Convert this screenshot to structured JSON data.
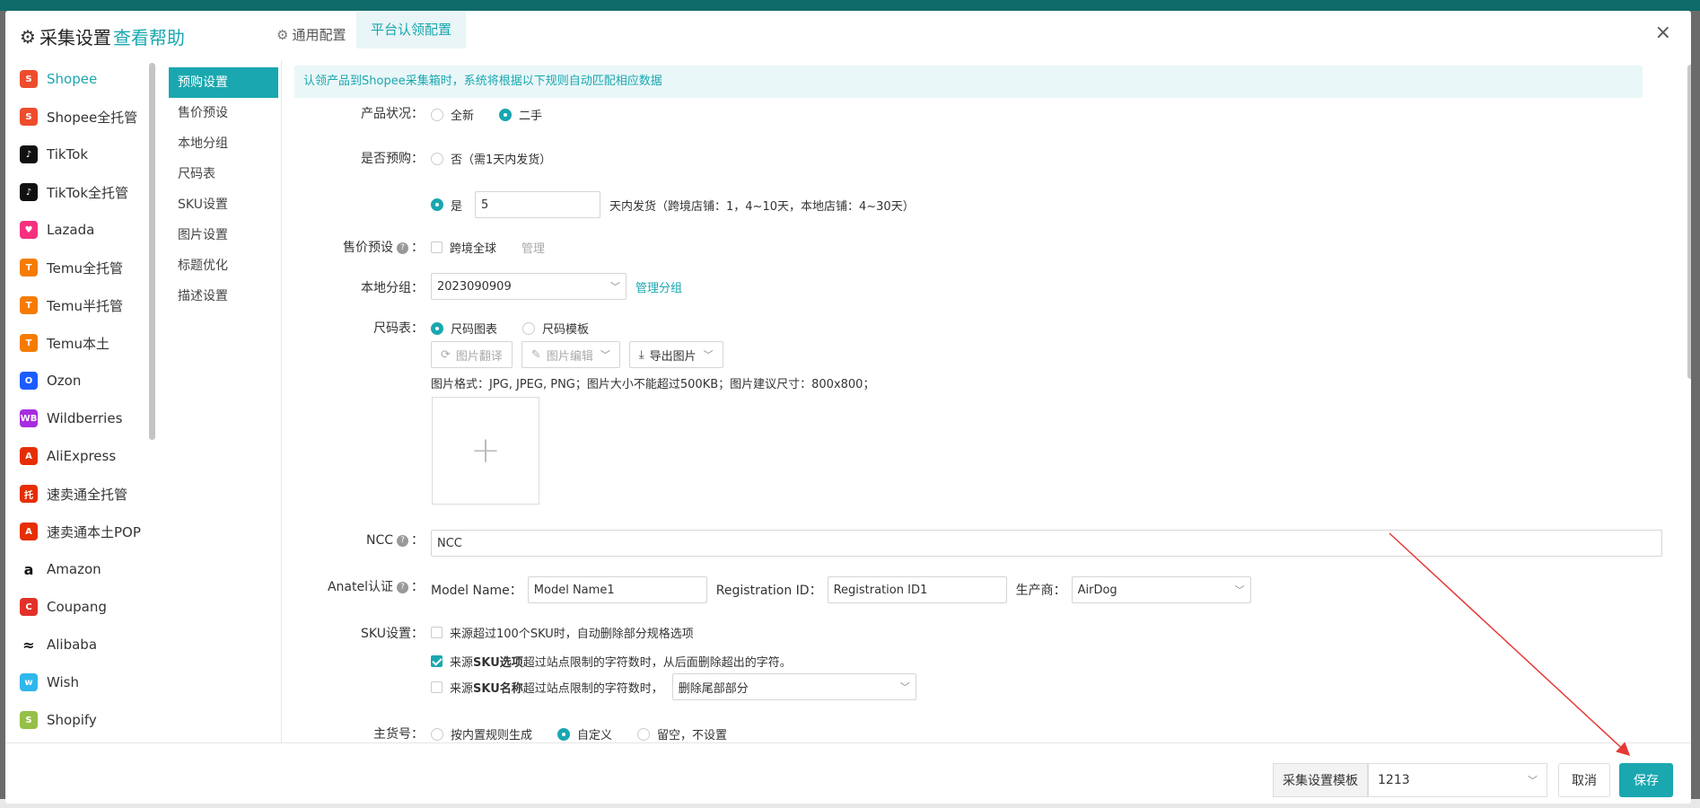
{
  "header": {
    "title": "采集设置",
    "help": "查看帮助",
    "tabs": [
      {
        "label": "通用配置"
      },
      {
        "label": "平台认领配置"
      }
    ],
    "close": "×"
  },
  "platforms": [
    {
      "label": "Shopee",
      "color": "#ee4d2d",
      "glyph": "S"
    },
    {
      "label": "Shopee全托管",
      "color": "#ee4d2d",
      "glyph": "S"
    },
    {
      "label": "TikTok",
      "color": "#111111",
      "glyph": "♪"
    },
    {
      "label": "TikTok全托管",
      "color": "#111111",
      "glyph": "♪"
    },
    {
      "label": "Lazada",
      "color": "#f5317f",
      "glyph": "♥"
    },
    {
      "label": "Temu全托管",
      "color": "#f57c00",
      "glyph": "T"
    },
    {
      "label": "Temu半托管",
      "color": "#f57c00",
      "glyph": "T"
    },
    {
      "label": "Temu本土",
      "color": "#f57c00",
      "glyph": "T"
    },
    {
      "label": "Ozon",
      "color": "#1a5cff",
      "glyph": "O"
    },
    {
      "label": "Wildberries",
      "color": "#a72ce0",
      "glyph": "WB"
    },
    {
      "label": "AliExpress",
      "color": "#e62e04",
      "glyph": "A"
    },
    {
      "label": "速卖通全托管",
      "color": "#e62e04",
      "glyph": "托"
    },
    {
      "label": "速卖通本土POP",
      "color": "#e62e04",
      "glyph": "A"
    },
    {
      "label": "Amazon",
      "color": "#ffffff",
      "glyph": "a"
    },
    {
      "label": "Coupang",
      "color": "#e2312b",
      "glyph": "C"
    },
    {
      "label": "Alibaba",
      "color": "#ffffff",
      "glyph": "≈"
    },
    {
      "label": "Wish",
      "color": "#2fb7ec",
      "glyph": "w"
    },
    {
      "label": "Shopify",
      "color": "#95bf47",
      "glyph": "S"
    }
  ],
  "subnav": [
    "预购设置",
    "售价预设",
    "本地分组",
    "尺码表",
    "SKU设置",
    "图片设置",
    "标题优化",
    "描述设置"
  ],
  "info": "认领产品到Shopee采集箱时，系统将根据以下规则自动匹配相应数据",
  "form": {
    "condition": {
      "label": "产品状况：",
      "options": [
        "全新",
        "二手"
      ]
    },
    "preorder": {
      "label": "是否预购：",
      "no": "否（需1天内发货）",
      "yes": "是",
      "days": "5",
      "suffix": "天内发货（跨境店铺：1，4~10天，本地店铺：4~30天）"
    },
    "price": {
      "label": "售价预设",
      "colon": "：",
      "option": "跨境全球",
      "manage": "管理"
    },
    "group": {
      "label": "本地分组：",
      "value": "2023090909",
      "manage": "管理分组"
    },
    "size": {
      "label": "尺码表：",
      "options": [
        "尺码图表",
        "尺码模板"
      ],
      "btn_translate": "图片翻译",
      "btn_edit": "图片编辑",
      "btn_export": "导出图片",
      "hint": "图片格式：JPG, JPEG, PNG；图片大小不能超过500KB；图片建议尺寸：800x800；",
      "plus": "+"
    },
    "ncc": {
      "label": "NCC",
      "colon": "：",
      "value": "NCC"
    },
    "anatel": {
      "label": "Anatel认证",
      "colon": "：",
      "model_label": "Model Name：",
      "model_value": "Model Name1",
      "reg_label": "Registration ID：",
      "reg_value": "Registration ID1",
      "mfr_label": "生产商：",
      "mfr_value": "AirDog"
    },
    "sku": {
      "label": "SKU设置：",
      "opt1": "来源超过100个SKU时，自动删除部分规格选项",
      "opt2_pre": "来源",
      "opt2_bold": "SKU选项",
      "opt2_post": "超过站点限制的字符数时，从后面删除超出的字符。",
      "opt3_pre": "来源",
      "opt3_bold": "SKU名称",
      "opt3_post": "超过站点限制的字符数时，",
      "opt3_select": "删除尾部部分"
    },
    "mainsku": {
      "label": "主货号：",
      "options": [
        "按内置规则生成",
        "自定义",
        "留空，不设置"
      ]
    }
  },
  "footer": {
    "template_label": "采集设置模板",
    "template_value": "1213",
    "cancel": "取消",
    "save": "保存"
  },
  "colors": {
    "accent": "#1aa7b0",
    "arrow": "#e53935"
  }
}
